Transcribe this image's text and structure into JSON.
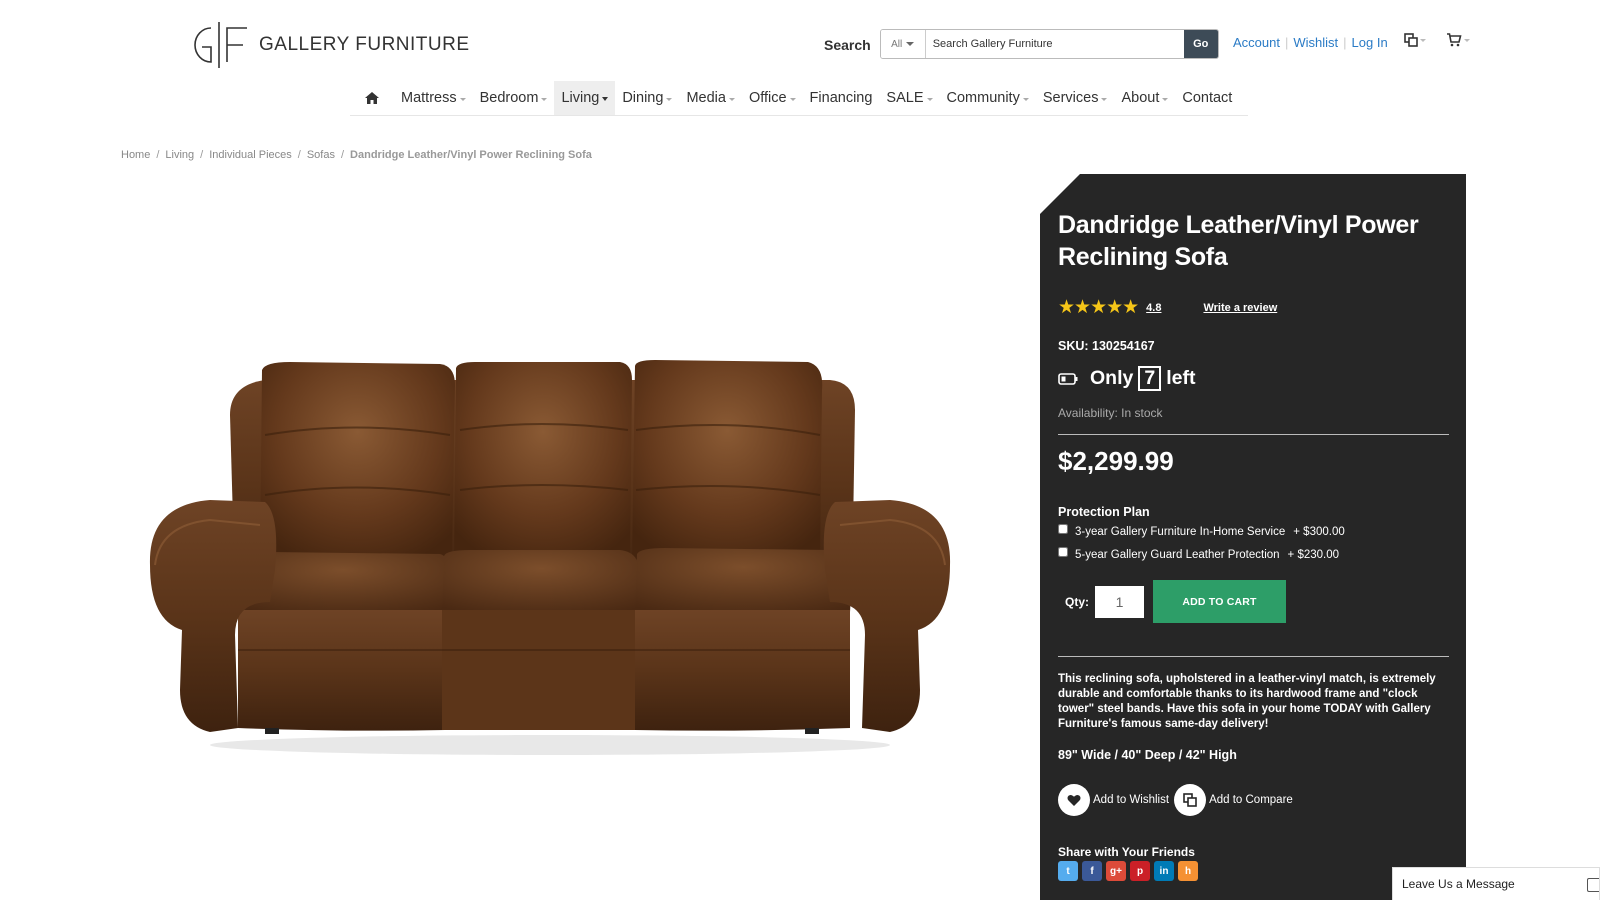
{
  "header": {
    "logo_text": "GALLERY FURNITURE",
    "logo_mark": "GF",
    "search_label": "Search",
    "search_category": "All",
    "search_placeholder": "Search Gallery Furniture",
    "search_button": "Go",
    "links": [
      "Account",
      "Wishlist",
      "Log In"
    ],
    "icons": [
      "compare-icon",
      "cart-icon"
    ]
  },
  "nav": {
    "home_icon": "home-icon",
    "items": [
      {
        "label": "Mattress",
        "dropdown": true
      },
      {
        "label": "Bedroom",
        "dropdown": true
      },
      {
        "label": "Living",
        "dropdown": true
      },
      {
        "label": "Dining",
        "dropdown": true
      },
      {
        "label": "Media",
        "dropdown": true
      },
      {
        "label": "Office",
        "dropdown": true
      },
      {
        "label": "Financing",
        "dropdown": false
      },
      {
        "label": "SALE",
        "dropdown": true
      },
      {
        "label": "Community",
        "dropdown": true
      },
      {
        "label": "Services",
        "dropdown": true
      },
      {
        "label": "About",
        "dropdown": true
      },
      {
        "label": "Contact",
        "dropdown": false
      }
    ],
    "active": "Living"
  },
  "breadcrumb": {
    "items": [
      "Home",
      "Living",
      "Individual Pieces",
      "Sofas"
    ],
    "current": "Dandridge Leather/Vinyl Power Reclining Sofa",
    "separator": "/"
  },
  "product": {
    "title": "Dandridge Leather/Vinyl Power Reclining Sofa",
    "stars": "★★★★★",
    "rating": "4.8",
    "write_review": "Write a review",
    "sku": "SKU: 130254167",
    "stock_prefix": "Only",
    "stock_count": "7",
    "stock_suffix": "left",
    "availability": "Availability: In stock",
    "price": "$2,299.99",
    "protection_title": "Protection Plan",
    "protection_options": [
      {
        "label": "3-year Gallery Furniture In-Home Service",
        "price": "+ $300.00",
        "checked": false
      },
      {
        "label": "5-year Gallery Guard Leather Protection",
        "price": "+ $230.00",
        "checked": false
      }
    ],
    "qty_label": "Qty:",
    "qty_value": "1",
    "add_to_cart": "ADD TO CART",
    "description": "This reclining sofa, upholstered in a leather-vinyl match, is extremely durable and comfortable thanks to its hardwood frame and \"clock tower\" steel bands. Have this sofa in your home TODAY with Gallery Furniture's famous same-day delivery!",
    "dimensions": "89\" Wide / 40\" Deep / 42\" High",
    "add_to_wishlist": "Add to Wishlist",
    "add_to_compare": "Add to Compare",
    "share_title": "Share with Your Friends",
    "share_buttons": [
      {
        "name": "twitter",
        "glyph": "t",
        "color": "#55acee"
      },
      {
        "name": "facebook",
        "glyph": "f",
        "color": "#3b5998"
      },
      {
        "name": "google-plus",
        "glyph": "g+",
        "color": "#dd4b39"
      },
      {
        "name": "pinterest",
        "glyph": "p",
        "color": "#cb2027"
      },
      {
        "name": "linkedin",
        "glyph": "in",
        "color": "#007bb6"
      },
      {
        "name": "houzz",
        "glyph": "h",
        "color": "#f59133"
      }
    ]
  },
  "chat": {
    "label": "Leave Us a Message"
  },
  "colors": {
    "panel_bg": "#262626",
    "link_blue": "#2a7bc6",
    "cart_green": "#2d9e68",
    "star_yellow": "#f5c518",
    "go_button": "#3d4b57"
  }
}
